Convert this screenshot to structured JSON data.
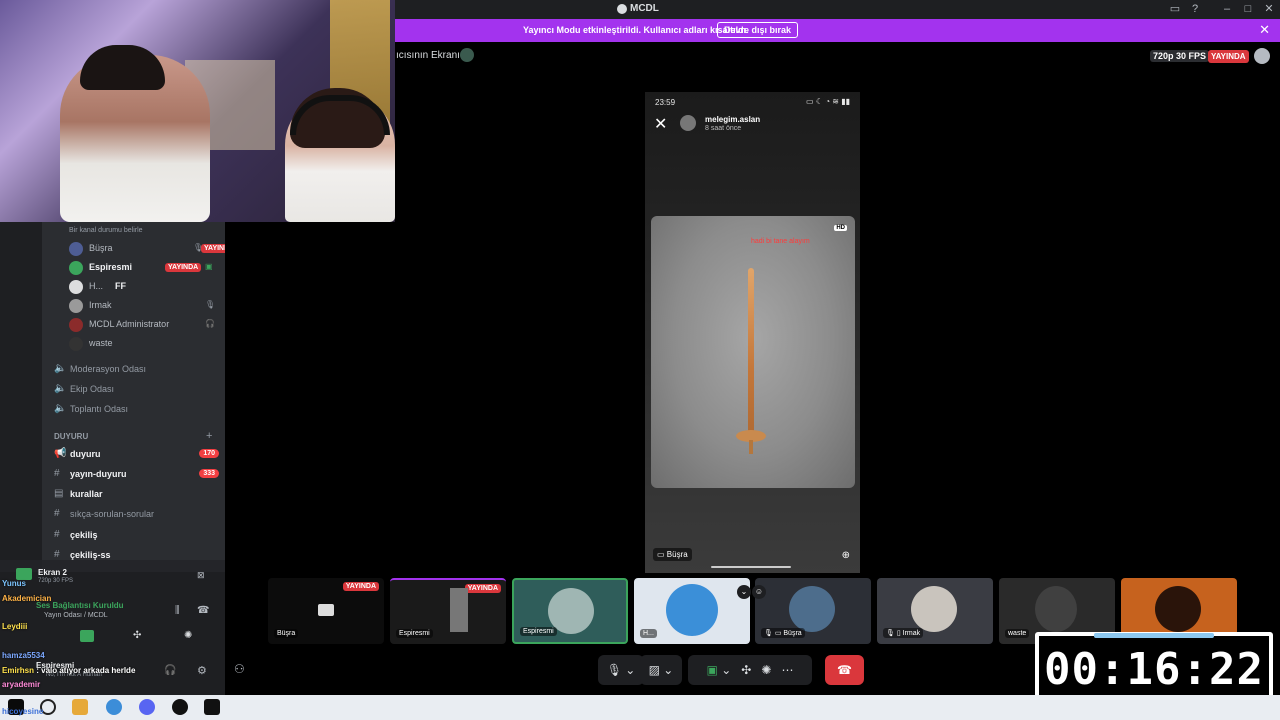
{
  "app": {
    "title": "MCDL"
  },
  "banner": {
    "message": "Yayıncı Modu etkinleştirildi. Kullanıcı adları kısaltıldı.",
    "button": "Devre dışı bırak",
    "close": "✕"
  },
  "stream": {
    "title": "ıcısının Ekranı",
    "quality": "720p 30 FPS",
    "live": "YAYINDA"
  },
  "sidebar": {
    "status_hint": "Bir kanal durumu belirle",
    "voice_users": [
      {
        "name": "Büşra",
        "live": "YAYINDA"
      },
      {
        "name": "Espiresmi",
        "live": "YAYINDA"
      },
      {
        "name": "H...",
        "suffix": "FF"
      },
      {
        "name": "Irmak"
      },
      {
        "name": "MCDL Administrator"
      },
      {
        "name": "waste"
      }
    ],
    "voice_channels": [
      {
        "name": "Moderasyon Odası"
      },
      {
        "name": "Ekip Odası"
      },
      {
        "name": "Toplantı Odası"
      }
    ],
    "category": "DUYURU",
    "text_channels": [
      {
        "name": "duyuru",
        "badge": "170"
      },
      {
        "name": "yayın-duyuru",
        "badge": "333"
      },
      {
        "name": "kurallar"
      },
      {
        "name": "sıkça-sorulan-sorular"
      },
      {
        "name": "çekiliş"
      },
      {
        "name": "çekiliş-ss"
      }
    ]
  },
  "voice_panel": {
    "screen_label": "Ekran 2",
    "fps_label": "720p 30 FPS",
    "connected": "Ses Bağlantısı Kuruldu",
    "room": "Yayın Odası / MCDL",
    "user": "Espiresmi",
    "user_status": "No, I'm Not A Human"
  },
  "overlay_chat": [
    {
      "user": "Yunus",
      "text": ""
    },
    {
      "user": "Akademician",
      "text": ""
    },
    {
      "user": "Leydiii",
      "text": ""
    },
    {
      "user": "hamza5534",
      "text": ""
    },
    {
      "user": "Emirhsn",
      "text": "valo atıyor arkada herlde"
    },
    {
      "user": "aryademir",
      "text": ""
    },
    {
      "user": "hicoyesine",
      "text": ""
    }
  ],
  "story": {
    "time": "23:59",
    "username": "melegim.aslan",
    "posted": "8 saat önce",
    "hd": "HD",
    "caption": "hadi bi tane alayım",
    "viewer_chip": "Büşra"
  },
  "tiles": [
    {
      "label": "Büşra",
      "live": "YAYINDA"
    },
    {
      "label": "Espiresmi",
      "live": "YAYINDA"
    },
    {
      "label": "Espiresmi"
    },
    {
      "label": "H..."
    },
    {
      "label": "Büşra"
    },
    {
      "label": "Irmak"
    },
    {
      "label": "waste"
    },
    {
      "label": ""
    }
  ],
  "timer": {
    "value": "00:16:22"
  },
  "colors": {
    "banner": "#a333ee",
    "live": "#da373c",
    "sidebar": "#2b2d31",
    "end_call": "#da373c"
  },
  "icons": {
    "mic": "mic-icon",
    "camera": "camera-off-icon",
    "screen_share": "screen-share-icon",
    "activities": "activities-icon",
    "soundboard": "soundboard-icon",
    "more": "more-icon",
    "leave": "leave-call-icon"
  }
}
